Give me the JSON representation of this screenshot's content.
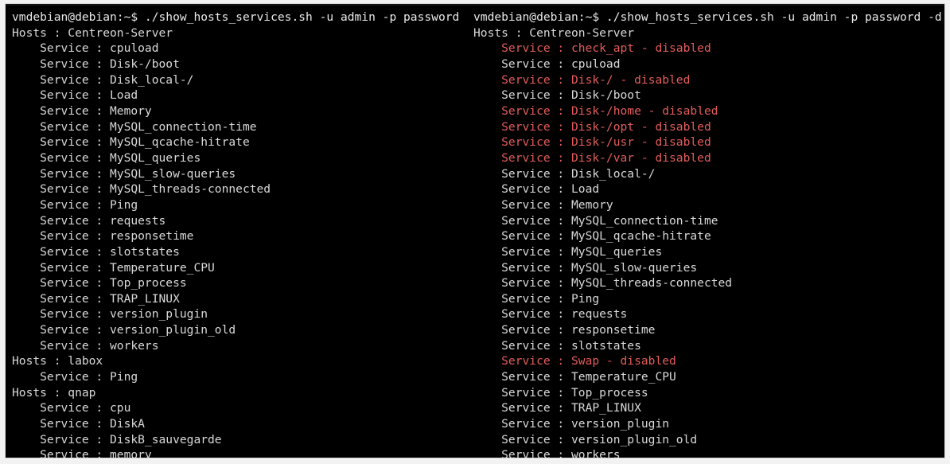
{
  "terminal": {
    "background_color": "#000000",
    "foreground_color": "#d9d9d9",
    "disabled_color": "#e35d5b",
    "frame_color": "#f2f2f2"
  },
  "panes": [
    {
      "name": "left-pane",
      "prompt": "vmdebian@debian:~$ ./show_hosts_services.sh -u admin -p password",
      "lines": [
        {
          "text": "Hosts : Centreon-Server",
          "kind": "host"
        },
        {
          "text": "    Service : cpuload",
          "kind": "service"
        },
        {
          "text": "    Service : Disk-/boot",
          "kind": "service"
        },
        {
          "text": "    Service : Disk_local-/",
          "kind": "service"
        },
        {
          "text": "    Service : Load",
          "kind": "service"
        },
        {
          "text": "    Service : Memory",
          "kind": "service"
        },
        {
          "text": "    Service : MySQL_connection-time",
          "kind": "service"
        },
        {
          "text": "    Service : MySQL_qcache-hitrate",
          "kind": "service"
        },
        {
          "text": "    Service : MySQL_queries",
          "kind": "service"
        },
        {
          "text": "    Service : MySQL_slow-queries",
          "kind": "service"
        },
        {
          "text": "    Service : MySQL_threads-connected",
          "kind": "service"
        },
        {
          "text": "    Service : Ping",
          "kind": "service"
        },
        {
          "text": "    Service : requests",
          "kind": "service"
        },
        {
          "text": "    Service : responsetime",
          "kind": "service"
        },
        {
          "text": "    Service : slotstates",
          "kind": "service"
        },
        {
          "text": "    Service : Temperature_CPU",
          "kind": "service"
        },
        {
          "text": "    Service : Top_process",
          "kind": "service"
        },
        {
          "text": "    Service : TRAP_LINUX",
          "kind": "service"
        },
        {
          "text": "    Service : version_plugin",
          "kind": "service"
        },
        {
          "text": "    Service : version_plugin_old",
          "kind": "service"
        },
        {
          "text": "    Service : workers",
          "kind": "service"
        },
        {
          "text": "Hosts : labox",
          "kind": "host"
        },
        {
          "text": "    Service : Ping",
          "kind": "service"
        },
        {
          "text": "Hosts : qnap",
          "kind": "host"
        },
        {
          "text": "    Service : cpu",
          "kind": "service"
        },
        {
          "text": "    Service : DiskA",
          "kind": "service"
        },
        {
          "text": "    Service : DiskB_sauvegarde",
          "kind": "service"
        },
        {
          "text": "    Service : memory",
          "kind": "service"
        }
      ]
    },
    {
      "name": "right-pane",
      "prompt": "vmdebian@debian:~$ ./show_hosts_services.sh -u admin -p password -d",
      "lines": [
        {
          "text": "Hosts : Centreon-Server",
          "kind": "host"
        },
        {
          "text": "    Service : check_apt - disabled",
          "kind": "disabled"
        },
        {
          "text": "    Service : cpuload",
          "kind": "service"
        },
        {
          "text": "    Service : Disk-/ - disabled",
          "kind": "disabled"
        },
        {
          "text": "    Service : Disk-/boot",
          "kind": "service"
        },
        {
          "text": "    Service : Disk-/home - disabled",
          "kind": "disabled"
        },
        {
          "text": "    Service : Disk-/opt - disabled",
          "kind": "disabled"
        },
        {
          "text": "    Service : Disk-/usr - disabled",
          "kind": "disabled"
        },
        {
          "text": "    Service : Disk-/var - disabled",
          "kind": "disabled"
        },
        {
          "text": "    Service : Disk_local-/",
          "kind": "service"
        },
        {
          "text": "    Service : Load",
          "kind": "service"
        },
        {
          "text": "    Service : Memory",
          "kind": "service"
        },
        {
          "text": "    Service : MySQL_connection-time",
          "kind": "service"
        },
        {
          "text": "    Service : MySQL_qcache-hitrate",
          "kind": "service"
        },
        {
          "text": "    Service : MySQL_queries",
          "kind": "service"
        },
        {
          "text": "    Service : MySQL_slow-queries",
          "kind": "service"
        },
        {
          "text": "    Service : MySQL_threads-connected",
          "kind": "service"
        },
        {
          "text": "    Service : Ping",
          "kind": "service"
        },
        {
          "text": "    Service : requests",
          "kind": "service"
        },
        {
          "text": "    Service : responsetime",
          "kind": "service"
        },
        {
          "text": "    Service : slotstates",
          "kind": "service"
        },
        {
          "text": "    Service : Swap - disabled",
          "kind": "disabled"
        },
        {
          "text": "    Service : Temperature_CPU",
          "kind": "service"
        },
        {
          "text": "    Service : Top_process",
          "kind": "service"
        },
        {
          "text": "    Service : TRAP_LINUX",
          "kind": "service"
        },
        {
          "text": "    Service : version_plugin",
          "kind": "service"
        },
        {
          "text": "    Service : version_plugin_old",
          "kind": "service"
        },
        {
          "text": "    Service : workers",
          "kind": "service"
        }
      ]
    }
  ]
}
